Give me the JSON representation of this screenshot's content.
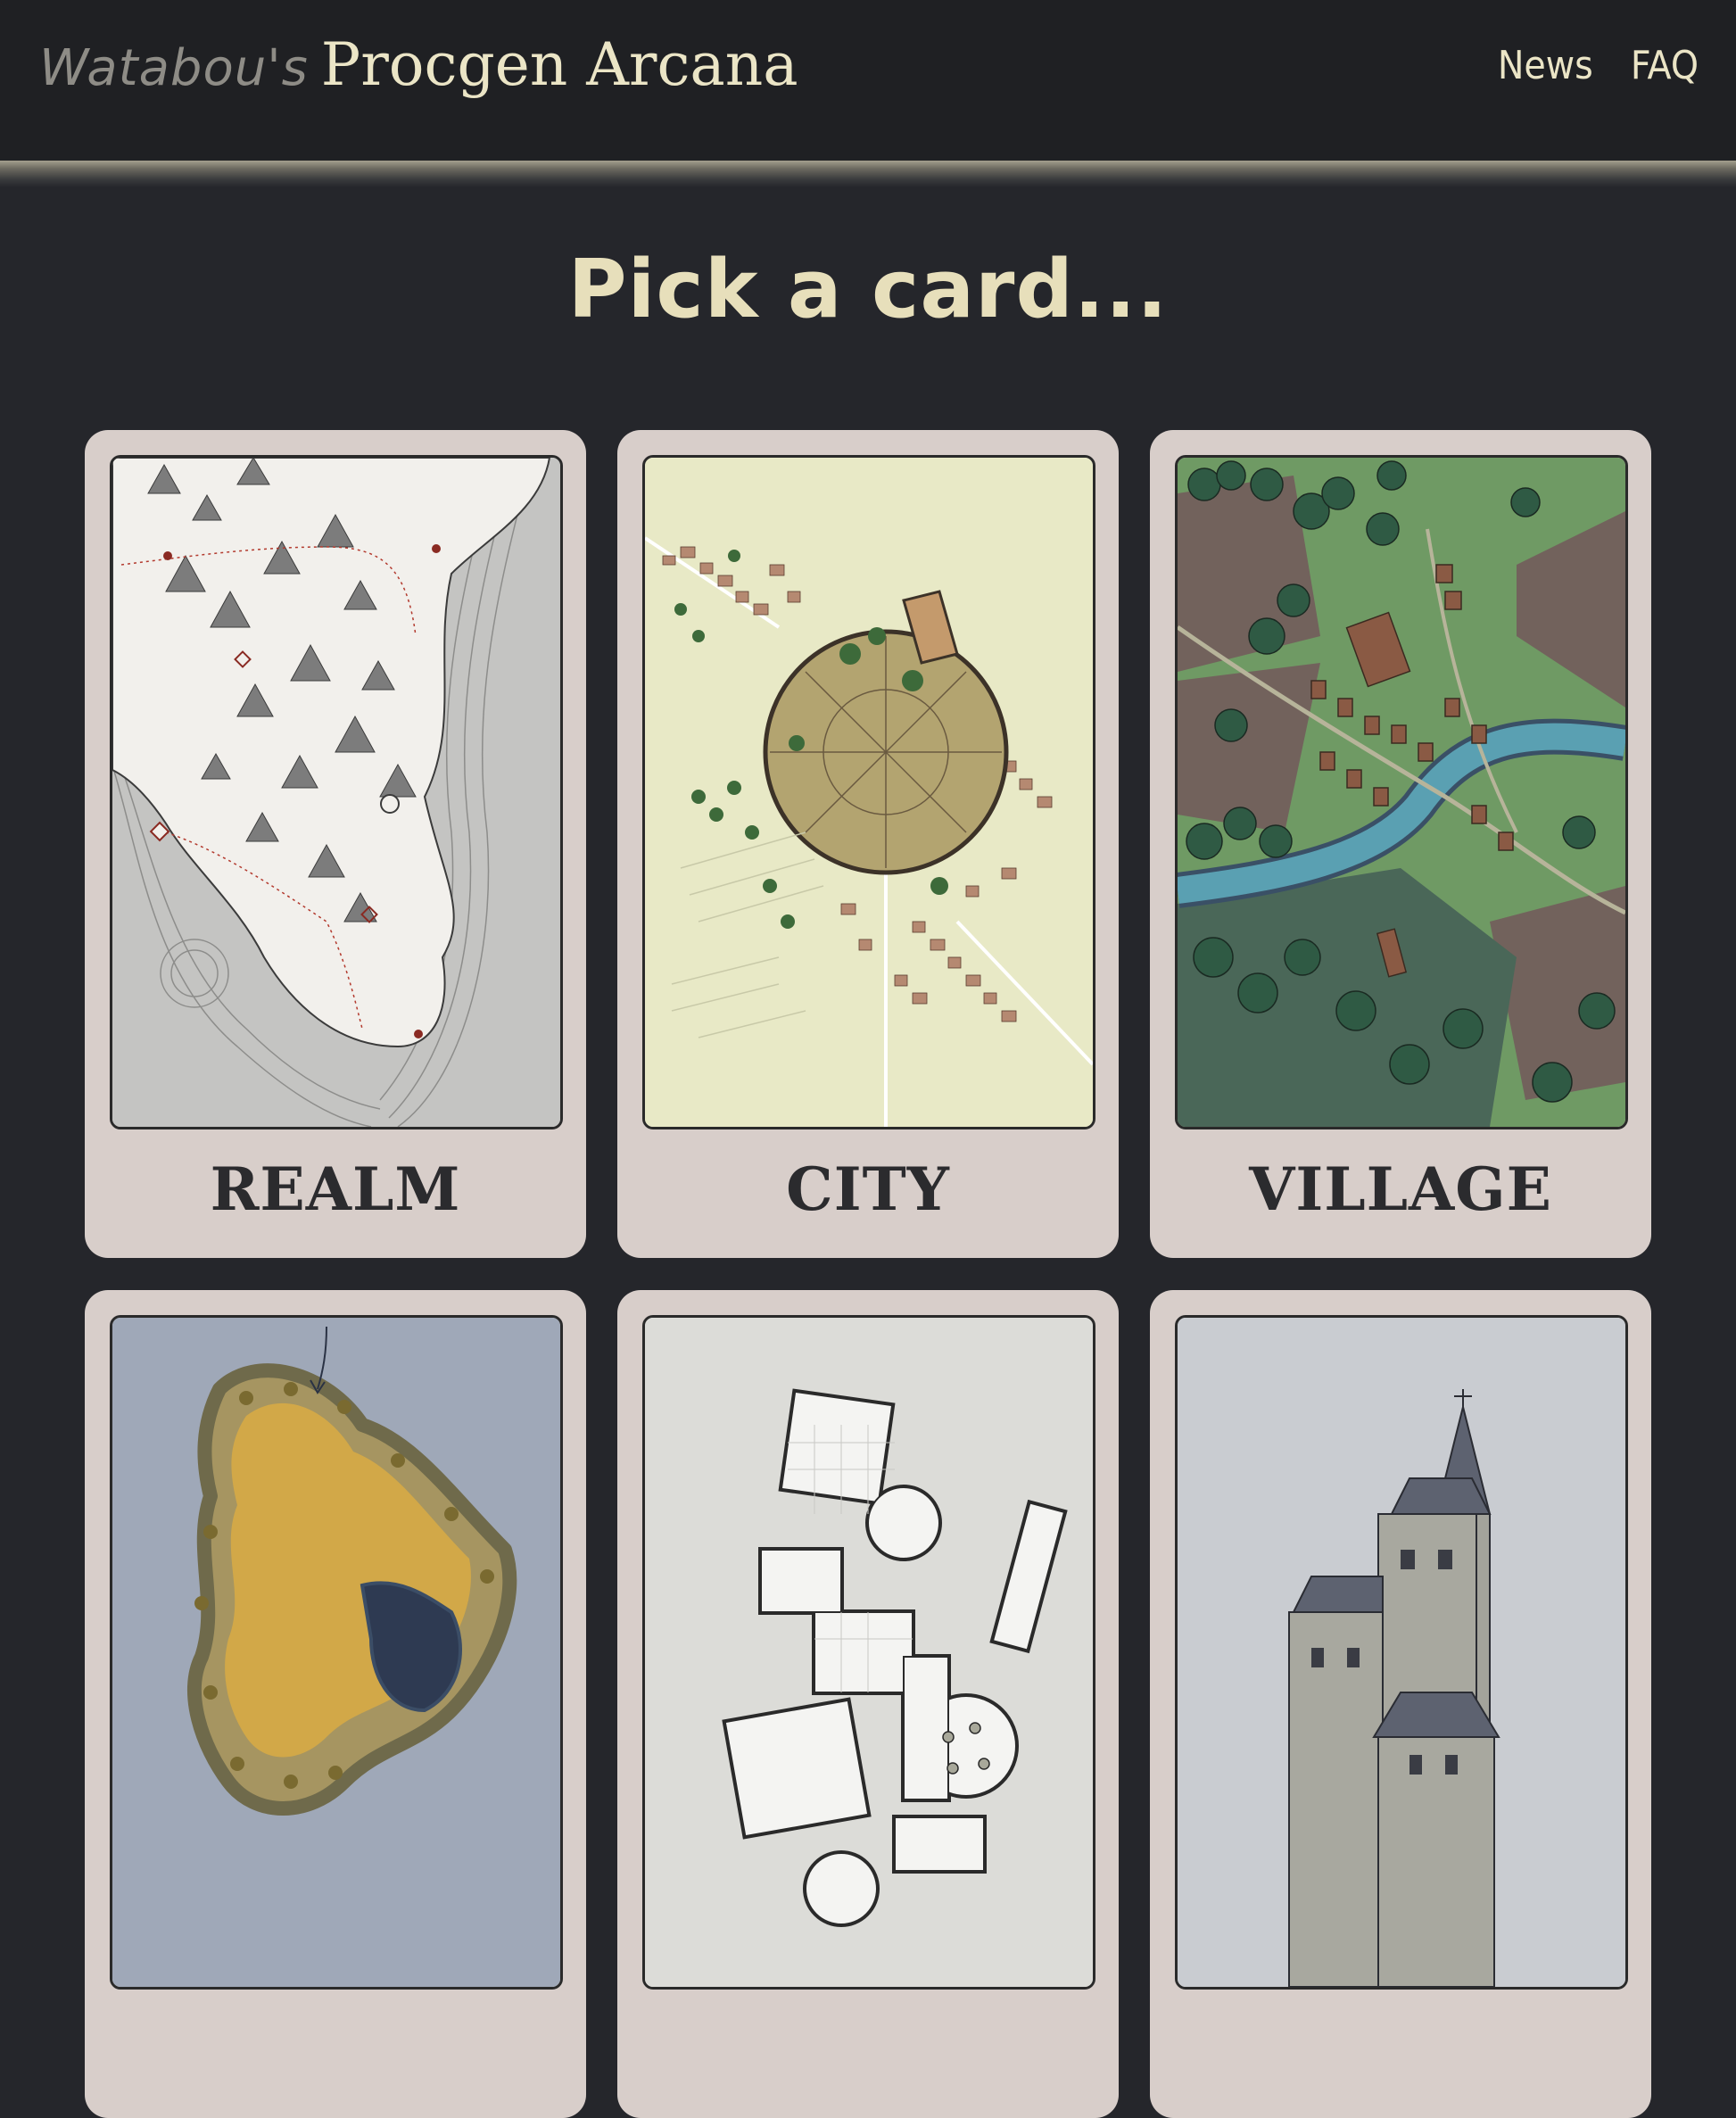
{
  "header": {
    "brand_prefix": "Watabou's",
    "brand_name": "Procgen Arcana",
    "nav": [
      {
        "label": "News"
      },
      {
        "label": "FAQ"
      }
    ]
  },
  "main": {
    "headline": "Pick a card...",
    "cards": [
      {
        "label": "REALM",
        "art_icon": "realm-map-illustration"
      },
      {
        "label": "CITY",
        "art_icon": "city-map-illustration"
      },
      {
        "label": "VILLAGE",
        "art_icon": "village-map-illustration"
      },
      {
        "label": "",
        "art_icon": "island-map-illustration"
      },
      {
        "label": "",
        "art_icon": "dungeon-map-illustration"
      },
      {
        "label": "",
        "art_icon": "building-illustration"
      }
    ]
  },
  "colors": {
    "page_bg": "#25262b",
    "header_bg": "#1f2023",
    "accent_text": "#ebe5c6",
    "card_bg": "#d8ceca"
  }
}
